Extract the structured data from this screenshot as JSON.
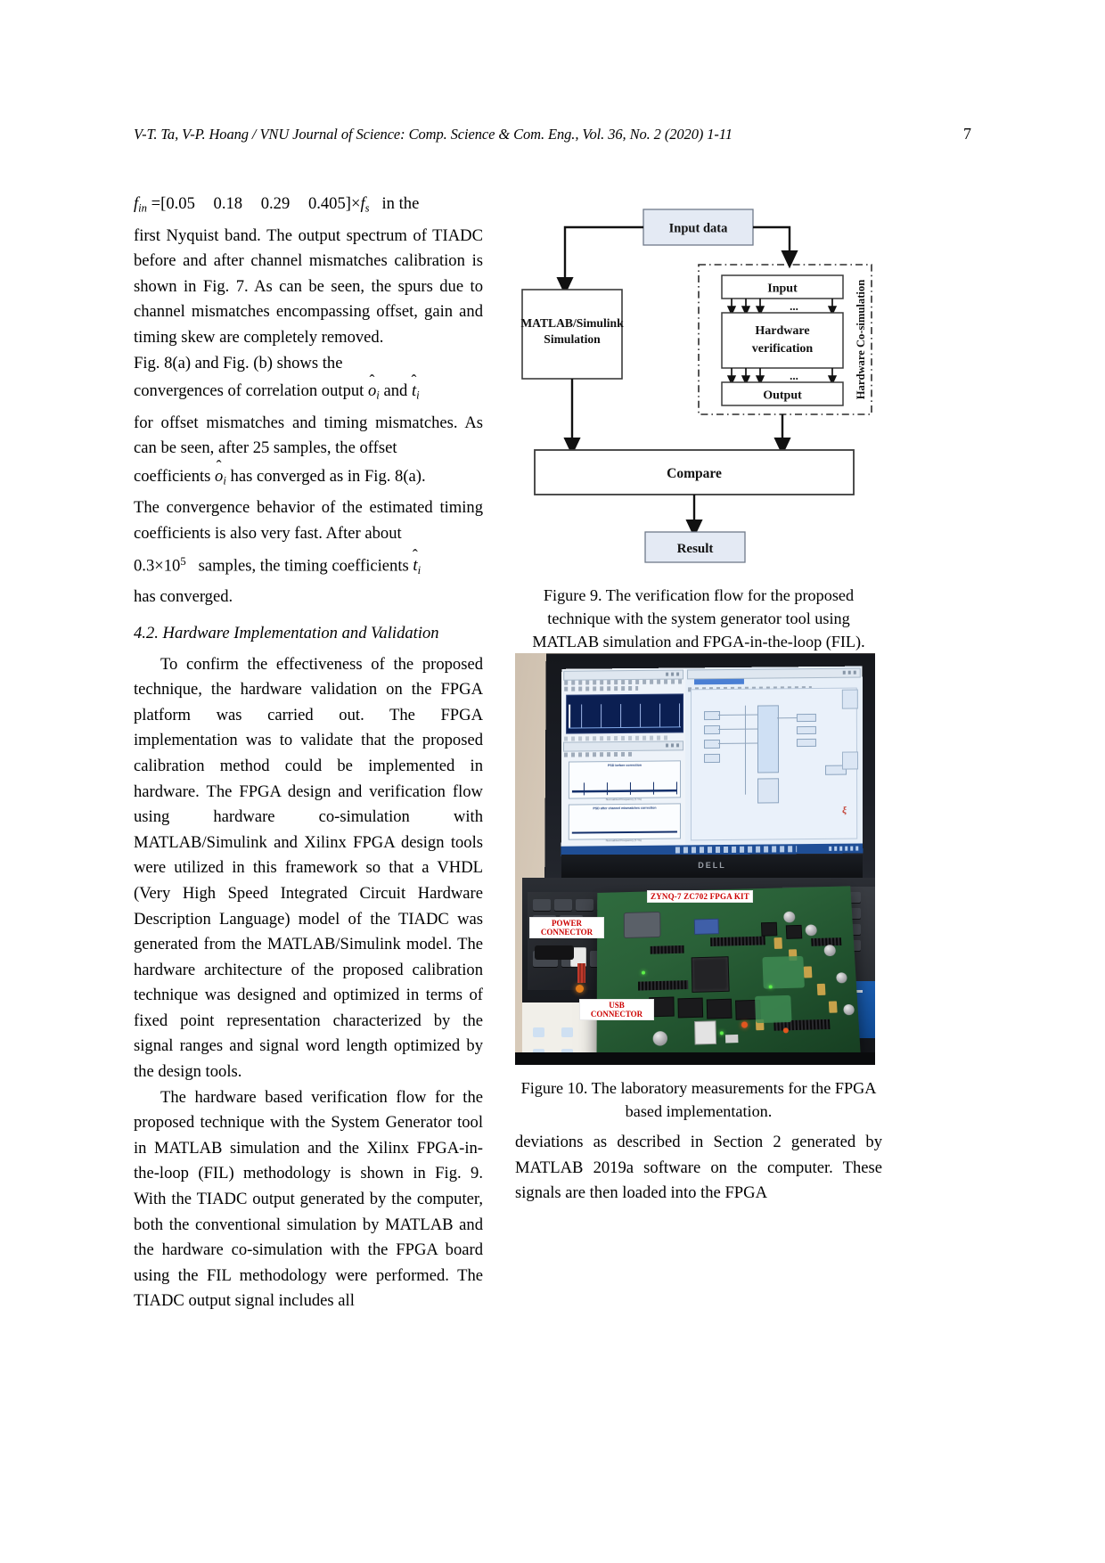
{
  "runhead": {
    "citation": "V-T. Ta, V-P. Hoang / VNU Journal of Science: Comp. Science & Com. Eng., Vol. 36, No. 2 (2020) 1-11",
    "page_number": "7"
  },
  "left_column": {
    "equation_line": {
      "f_in": "f",
      "f_in_sub": "in",
      "equals": "=[0.05",
      "v2": "0.18",
      "v3": "0.29",
      "v4": "0.405]×",
      "f_s": "f",
      "f_s_sub": "s",
      "tail": "in the"
    },
    "para1_rest": "first Nyquist band. The output spectrum of TIADC before and after channel mismatches calibration is shown in Fig. 7. As can be seen, the spurs   due to channel mismatches encompassing offset, gain and timing skew are completely removed.",
    "para2_a": "Fig.    8(a)    and    Fig.    (b)    shows    the",
    "para2_b": "convergences of correlation output",
    "para2_c": "and",
    "para2_d": "for offset mismatches and timing mismatches. As can be seen, after 25 samples, the  offset",
    "para2_e": "coefficients",
    "para2_f": "has converged as in Fig. 8(a).",
    "para2_g": "The convergence behavior of the estimated timing coefficients is also very fast. After about",
    "para2_h": "samples, the timing coefficients",
    "para2_i": "has converged.",
    "symbol_o": "o",
    "symbol_o_sub": "i",
    "symbol_t": "t",
    "symbol_t_sub": "i",
    "hat_mark": "ˆ",
    "num_03": "0.3×10",
    "num_03_exp": "5",
    "section_heading": "4.2. Hardware Implementation and Validation",
    "para3": "To confirm the effectiveness of the proposed technique, the hardware validation on the FPGA platform was carried out. The FPGA implementation was to validate that the proposed calibration method could be implemented in hardware. The FPGA design and verification flow using hardware co-simulation with MATLAB/Simulink and Xilinx FPGA design tools were utilized in this framework so that a VHDL (Very High Speed Integrated Circuit Hardware Description Language) model of the TIADC was generated from the MATLAB/Simulink model. The hardware architecture of the proposed calibration technique was designed and optimized in terms of fixed point representation characterized by the signal ranges and signal word length optimized by the design tools.",
    "para4": "The hardware based verification flow for the proposed technique with the System Generator tool in MATLAB simulation and the Xilinx FPGA-in-the-loop (FIL) methodology is shown in Fig. 9. With the TIADC output generated by the computer, both the conventional simulation by MATLAB and the hardware co-simulation with the FPGA board using the FIL methodology were performed. The TIADC output signal includes all"
  },
  "figure9": {
    "blocks": {
      "input_data": "Input data",
      "matlab_sim_l1": "MATLAB/Simulink",
      "matlab_sim_l2": "Simulation",
      "input": "Input",
      "hardware_verif_l1": "Hardware",
      "hardware_verif_l2": "verification",
      "output": "Output",
      "compare": "Compare",
      "result": "Result"
    },
    "ellipsis": "...",
    "side_label": "Hardware Co-simulation",
    "colors": {
      "accent_fill": "#e4eaf4",
      "box_stroke": "#3b3b3b",
      "arrow": "#111111"
    },
    "caption": "Figure 9. The verification flow for the proposed technique with the system generator tool using MATLAB simulation and FPGA-in-the-loop (FIL)."
  },
  "figure10": {
    "caption": "Figure 10. The laboratory measurements for the FPGA based implementation.",
    "annotations": {
      "kit": "ZYNQ-7 ZC702 FPGA KIT",
      "power": "POWER\nCONNECTOR",
      "usb": "USB\nCONNECTOR"
    },
    "laptop_brand": "DELL",
    "screen": {
      "plot1_title": "PSD before correction",
      "plot2_title": "PSD after channel mismatches correction",
      "axis_label": "Normalized Frequency (f / fs)",
      "matlab_logo": "ξ"
    },
    "annotation_color": "#cc0000"
  },
  "right_column": {
    "para_tail": "deviations as described in Section 2 generated by MATLAB 2019a software on the computer. These signals are then loaded into the FPGA"
  }
}
